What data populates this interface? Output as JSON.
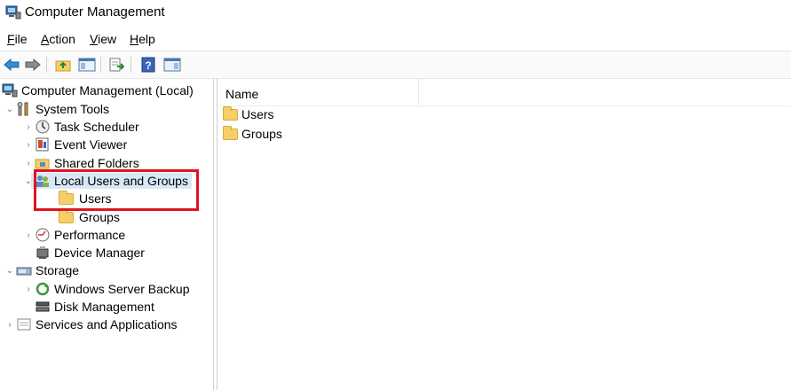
{
  "window": {
    "title": "Computer Management"
  },
  "menu": [
    {
      "label_first": "F",
      "label_rest": "ile"
    },
    {
      "label_first": "A",
      "label_rest": "ction"
    },
    {
      "label_first": "V",
      "label_rest": "iew"
    },
    {
      "label_first": "H",
      "label_rest": "elp"
    }
  ],
  "tree": {
    "root": "Computer Management (Local)",
    "system_tools": "System Tools",
    "task_scheduler": "Task Scheduler",
    "event_viewer": "Event Viewer",
    "shared_folders": "Shared Folders",
    "local_users_groups": "Local Users and Groups",
    "users": "Users",
    "groups": "Groups",
    "performance": "Performance",
    "device_manager": "Device Manager",
    "storage": "Storage",
    "windows_server_backup": "Windows Server Backup",
    "disk_management": "Disk Management",
    "services_apps": "Services and Applications"
  },
  "list": {
    "column_name": "Name",
    "items": [
      "Users",
      "Groups"
    ]
  },
  "colors": {
    "highlight": "#e0141e",
    "selection": "#d9e8f7",
    "folder": "#f6cf6b"
  }
}
